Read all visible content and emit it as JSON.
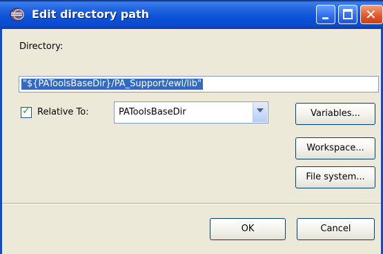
{
  "window": {
    "title": "Edit directory path",
    "title_icon": "eclipse-icon",
    "controls": [
      "minimize-icon",
      "maximize-icon",
      "close-icon"
    ],
    "close_glyph": "✕"
  },
  "directory": {
    "label": "Directory:",
    "value": "\"${PAToolsBaseDir}/PA_Support/ewl/lib\""
  },
  "relative": {
    "checked": true,
    "label": "Relative To:",
    "selected": "PAToolsBaseDir"
  },
  "buttons": {
    "variables": "Variables...",
    "workspace": "Workspace...",
    "file_system": "File system...",
    "ok": "OK",
    "cancel": "Cancel"
  },
  "colors": {
    "titlebar": "#0a4bd0",
    "selection": "#316ac5",
    "dialog_bg": "#ece9d8"
  }
}
